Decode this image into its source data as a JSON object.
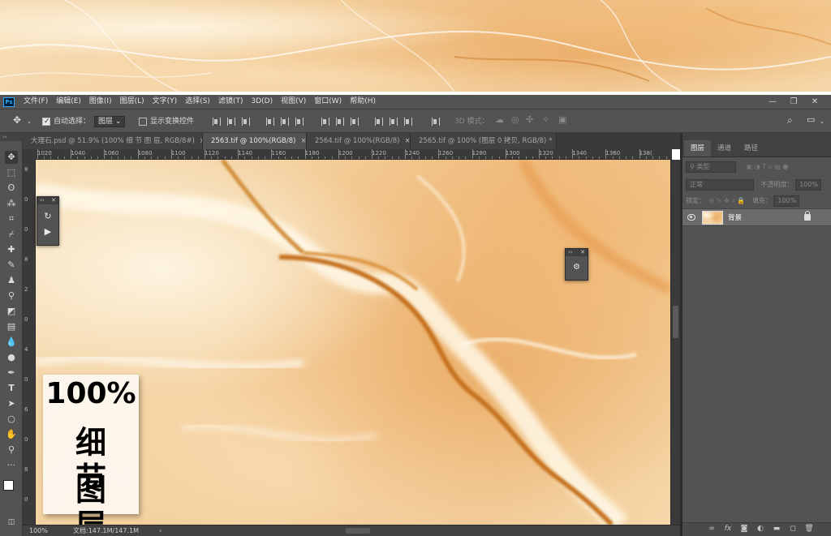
{
  "app": {
    "logo": "Ps"
  },
  "menubar": {
    "items": [
      "文件(F)",
      "编辑(E)",
      "图像(I)",
      "图层(L)",
      "文字(Y)",
      "选择(S)",
      "滤镜(T)",
      "3D(D)",
      "视图(V)",
      "窗口(W)",
      "帮助(H)"
    ],
    "window_controls": {
      "minimize": "—",
      "restore": "❐",
      "close": "✕"
    }
  },
  "options": {
    "auto_select_label": "自动选择：",
    "auto_select_checked": true,
    "auto_select_target": "图层",
    "show_transform_label": "显示变换控件",
    "show_transform_checked": false,
    "mode_3d_label": "3D 模式："
  },
  "tabs": [
    {
      "label": "大理石.psd @ 51.9% (100% 细 节 图 层, RGB/8#)",
      "close": "×",
      "active": false
    },
    {
      "label": "2563.tif @ 100%(RGB/8)",
      "close": "×",
      "active": true
    },
    {
      "label": "2564.tif @ 100%(RGB/8)",
      "close": "×",
      "active": false
    },
    {
      "label": "2565.tif @ 100% (图层 0 拷贝, RGB/8) *",
      "close": "×",
      "active": false
    }
  ],
  "ruler": {
    "top": [
      "1020",
      "1040",
      "1060",
      "1080",
      "1100",
      "1120",
      "1140",
      "1160",
      "1180",
      "1200",
      "1220",
      "1240",
      "1260",
      "1280",
      "1300",
      "1320",
      "1340",
      "1360",
      "138("
    ],
    "left": [
      "8",
      "0",
      "0",
      "8",
      "2",
      "0",
      "4",
      "0",
      "6",
      "0",
      "8",
      "0"
    ]
  },
  "overlay": {
    "line1": "100%",
    "line2": "细节",
    "line3": "图层"
  },
  "statusbar": {
    "zoom": "100%",
    "doc_info": "文档:147.1M/147.1M",
    "arrow": "›"
  },
  "layers_panel": {
    "tabs": [
      "图层",
      "通道",
      "路径"
    ],
    "filter_label": "类型",
    "blend_mode": "正常",
    "opacity_label": "不透明度：",
    "opacity_value": "100%",
    "lock_label": "锁定：",
    "fill_label": "填充：",
    "fill_value": "100%",
    "layers": [
      {
        "name": "背景",
        "visible": true,
        "locked": true
      }
    ],
    "bottom_icons": [
      "link-icon",
      "fx-icon",
      "mask-icon",
      "adjustment-icon",
      "group-icon",
      "new-layer-icon",
      "delete-icon"
    ]
  },
  "colors": {
    "ui_dark": "#535353",
    "ui_darker": "#3a3a3a",
    "marble_light": "#f6dcb4",
    "marble_vein": "#c97a1e"
  }
}
